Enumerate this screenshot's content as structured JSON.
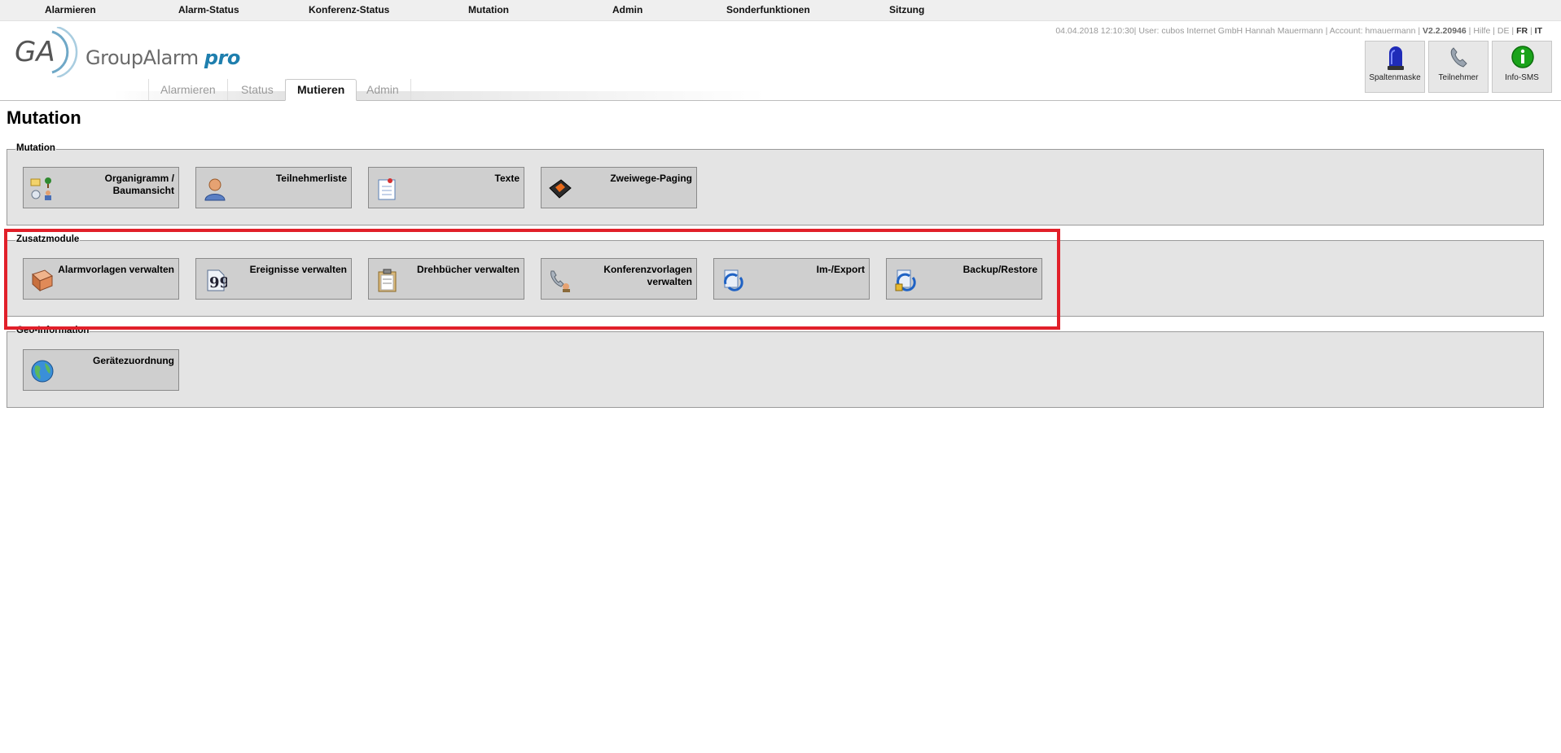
{
  "topmenu": {
    "items": [
      "Alarmieren",
      "Alarm-Status",
      "Konferenz-Status",
      "Mutation",
      "Admin",
      "Sonderfunktionen",
      "Sitzung"
    ]
  },
  "logo": {
    "brand": "GroupAlarm",
    "suffix": "pro",
    "mark": "GA"
  },
  "infobar": {
    "datetime": "04.04.2018 12:10:30",
    "user": "User: cubos Internet GmbH Hannah Mauermann",
    "account": "Account: hmauermann",
    "version": "V2.2.20946",
    "help": "Hilfe",
    "lang_de": "DE",
    "lang_fr": "FR",
    "lang_it": "IT",
    "sep": "|"
  },
  "toolbar": {
    "buttons": [
      {
        "label": "Spaltenmaske",
        "icon": "blue-siren-icon"
      },
      {
        "label": "Teilnehmer",
        "icon": "telephone-icon"
      },
      {
        "label": "Info-SMS",
        "icon": "info-icon"
      }
    ]
  },
  "tabs": {
    "items": [
      "Alarmieren",
      "Status",
      "Mutieren",
      "Admin"
    ],
    "active": "Mutieren"
  },
  "page": {
    "title": "Mutation"
  },
  "groups": {
    "mutation": {
      "legend": "Mutation",
      "tiles": [
        {
          "label": "Organigramm / Baumansicht",
          "icon": "org-tree-icon"
        },
        {
          "label": "Teilnehmerliste",
          "icon": "user-icon"
        },
        {
          "label": "Texte",
          "icon": "notepad-icon"
        },
        {
          "label": "Zweiwege-Paging",
          "icon": "pager-icon"
        }
      ]
    },
    "zusatz": {
      "legend": "Zusatzmodule",
      "tiles": [
        {
          "label": "Alarmvorlagen verwalten",
          "icon": "book-icon"
        },
        {
          "label": "Ereignisse verwalten",
          "icon": "quote-document-icon"
        },
        {
          "label": "Drehbücher verwalten",
          "icon": "clipboard-icon"
        },
        {
          "label": "Konferenzvorlagen verwalten",
          "icon": "conference-phone-icon"
        },
        {
          "label": "Im-/Export",
          "icon": "import-export-icon"
        },
        {
          "label": "Backup/Restore",
          "icon": "backup-restore-icon"
        }
      ]
    },
    "geo": {
      "legend": "Geo-Information",
      "tiles": [
        {
          "label": "Gerätezuordnung",
          "icon": "globe-icon"
        }
      ]
    }
  },
  "colors": {
    "accent": "#1f7fae",
    "highlight": "#e1202a",
    "panel": "#e4e4e4",
    "tile": "#cfcfcf"
  }
}
